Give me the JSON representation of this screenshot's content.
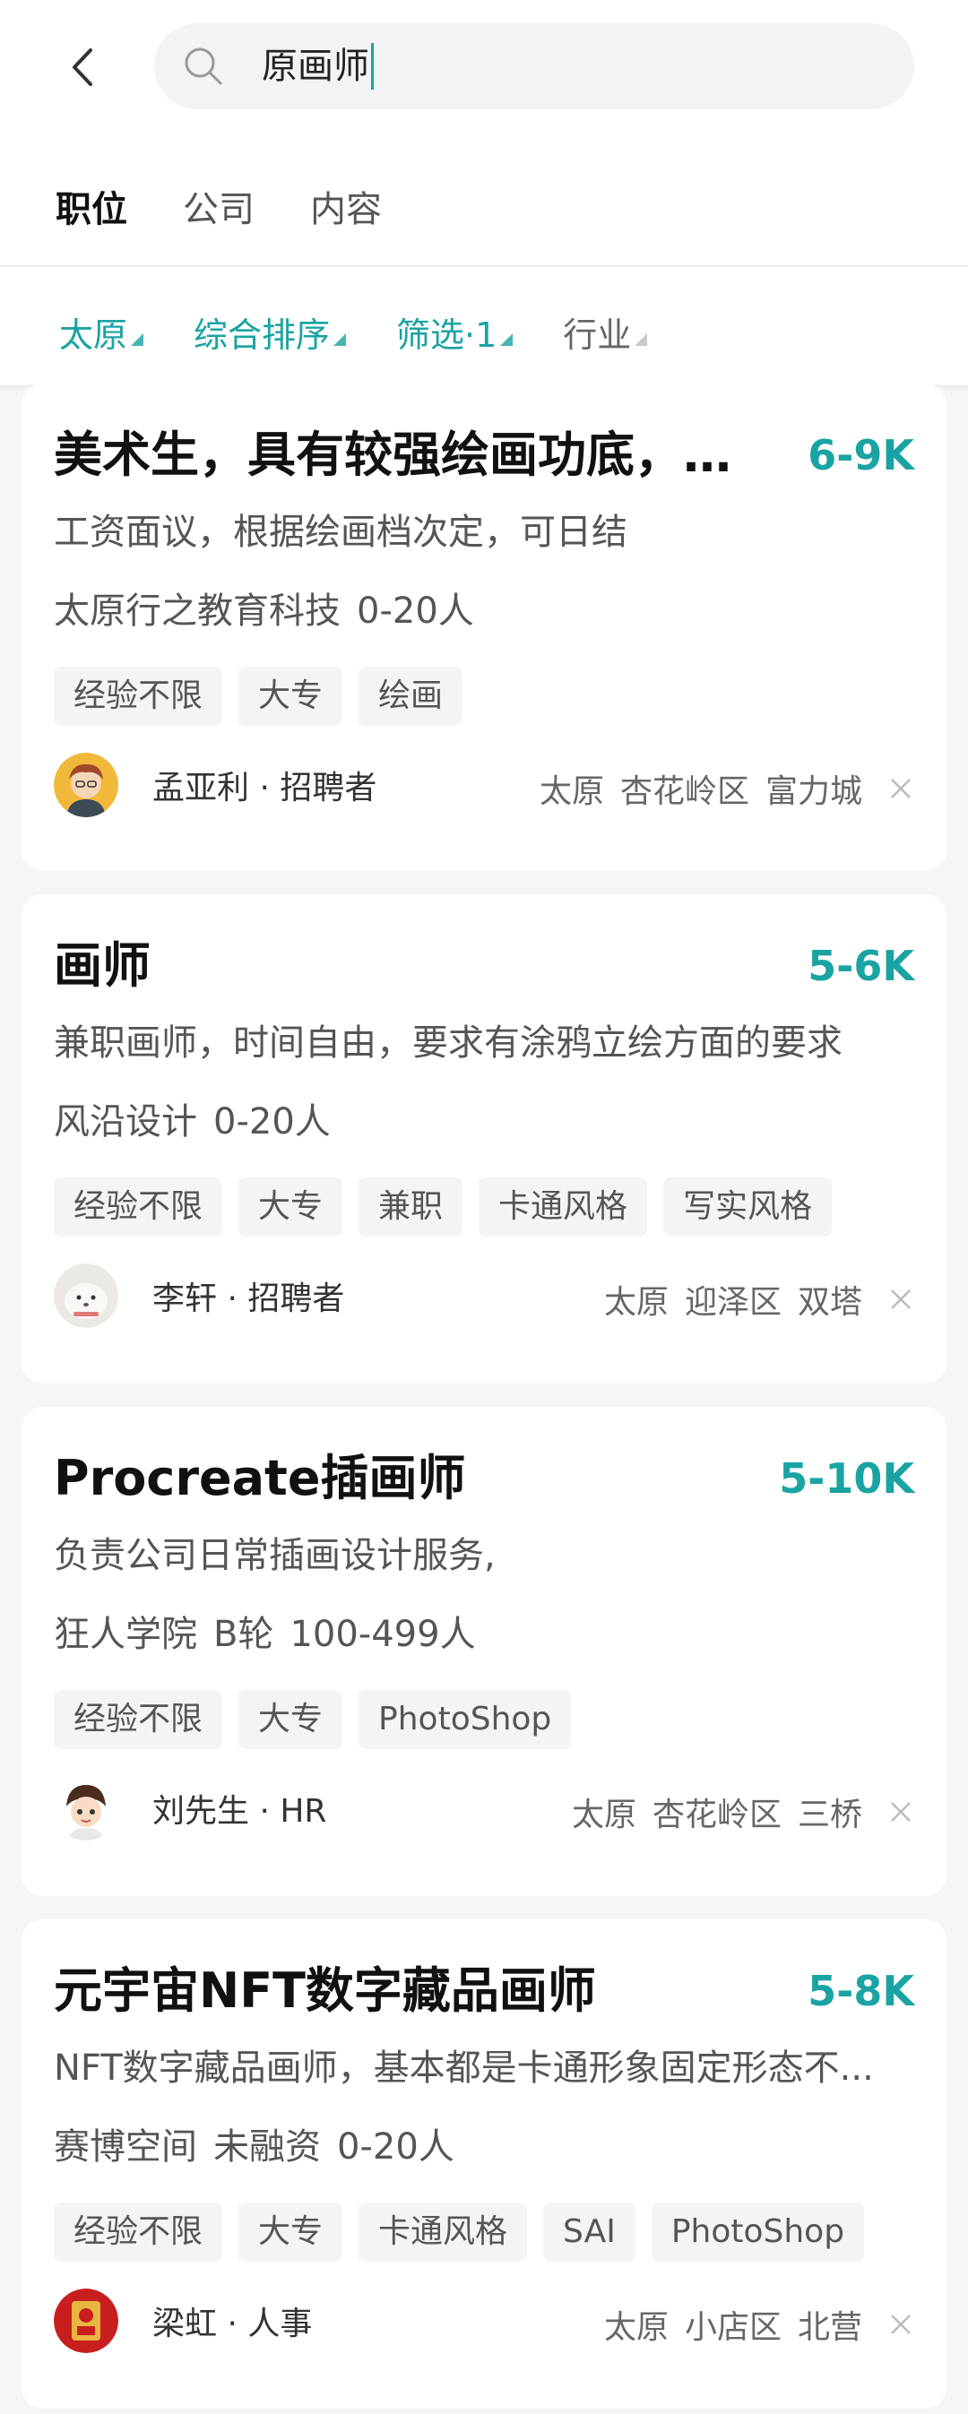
{
  "search": {
    "query": "原画师"
  },
  "tabs": [
    {
      "label": "职位"
    },
    {
      "label": "公司"
    },
    {
      "label": "内容"
    }
  ],
  "filters": [
    {
      "label": "太原"
    },
    {
      "label": "综合排序"
    },
    {
      "label": "筛选·1"
    },
    {
      "label": "行业"
    }
  ],
  "jobs": [
    {
      "title": "美术生，具有较强绘画功底，实...",
      "salary": "6-9K",
      "desc": "工资面议，根据绘画档次定，可日结",
      "company": [
        "太原行之教育科技",
        "0-20人"
      ],
      "tags": [
        "经验不限",
        "大专",
        "绘画"
      ],
      "recruiter": "孟亚利 · 招聘者",
      "location": [
        "太原",
        "杏花岭区",
        "富力城"
      ]
    },
    {
      "title": "画师",
      "salary": "5-6K",
      "desc": "兼职画师，时间自由，要求有涂鸦立绘方面的要求",
      "company": [
        "风沿设计",
        "0-20人"
      ],
      "tags": [
        "经验不限",
        "大专",
        "兼职",
        "卡通风格",
        "写实风格"
      ],
      "recruiter": "李轩 · 招聘者",
      "location": [
        "太原",
        "迎泽区",
        "双塔"
      ]
    },
    {
      "title": "Procreate插画师",
      "salary": "5-10K",
      "desc": "负责公司日常插画设计服务,",
      "company": [
        "狂人学院",
        "B轮",
        "100-499人"
      ],
      "tags": [
        "经验不限",
        "大专",
        "PhotoShop"
      ],
      "recruiter": "刘先生 · HR",
      "location": [
        "太原",
        "杏花岭区",
        "三桥"
      ]
    },
    {
      "title": "元宇宙NFT数字藏品画师",
      "salary": "5-8K",
      "desc": "NFT数字藏品画师，基本都是卡通形象固定形态不...",
      "company": [
        "赛博空间",
        "未融资",
        "0-20人"
      ],
      "tags": [
        "经验不限",
        "大专",
        "卡通风格",
        "SAI",
        "PhotoShop"
      ],
      "recruiter": "梁虹 · 人事",
      "location": [
        "太原",
        "小店区",
        "北营"
      ]
    }
  ],
  "colors": {
    "accent": "#1aa3a3",
    "background": "#f4f5f7"
  }
}
